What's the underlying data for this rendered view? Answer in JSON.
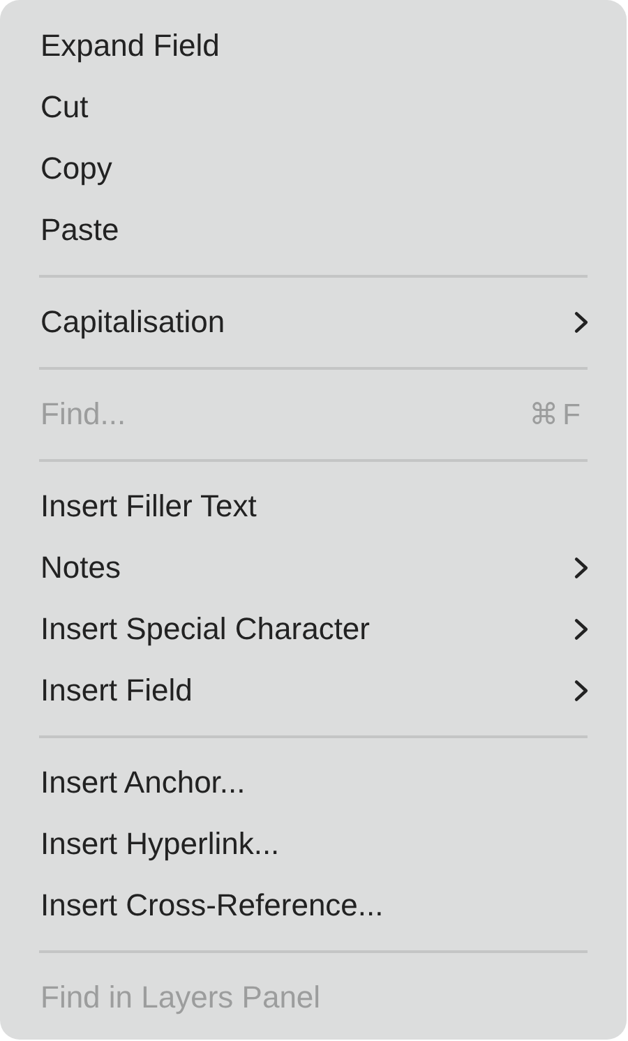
{
  "menu": {
    "items": [
      {
        "kind": "item",
        "label": "Expand Field",
        "disabled": false,
        "submenu": false
      },
      {
        "kind": "item",
        "label": "Cut",
        "disabled": false,
        "submenu": false
      },
      {
        "kind": "item",
        "label": "Copy",
        "disabled": false,
        "submenu": false
      },
      {
        "kind": "item",
        "label": "Paste",
        "disabled": false,
        "submenu": false
      },
      {
        "kind": "separator"
      },
      {
        "kind": "item",
        "label": "Capitalisation",
        "disabled": false,
        "submenu": true
      },
      {
        "kind": "separator"
      },
      {
        "kind": "item",
        "label": "Find...",
        "disabled": true,
        "submenu": false,
        "shortcut": "⌘F"
      },
      {
        "kind": "separator"
      },
      {
        "kind": "item",
        "label": "Insert Filler Text",
        "disabled": false,
        "submenu": false
      },
      {
        "kind": "item",
        "label": "Notes",
        "disabled": false,
        "submenu": true
      },
      {
        "kind": "item",
        "label": "Insert Special Character",
        "disabled": false,
        "submenu": true
      },
      {
        "kind": "item",
        "label": "Insert Field",
        "disabled": false,
        "submenu": true
      },
      {
        "kind": "separator"
      },
      {
        "kind": "item",
        "label": "Insert Anchor...",
        "disabled": false,
        "submenu": false
      },
      {
        "kind": "item",
        "label": "Insert Hyperlink...",
        "disabled": false,
        "submenu": false
      },
      {
        "kind": "item",
        "label": "Insert Cross-Reference...",
        "disabled": false,
        "submenu": false
      },
      {
        "kind": "separator"
      },
      {
        "kind": "item",
        "label": "Find in Layers Panel",
        "disabled": true,
        "submenu": false
      }
    ]
  }
}
